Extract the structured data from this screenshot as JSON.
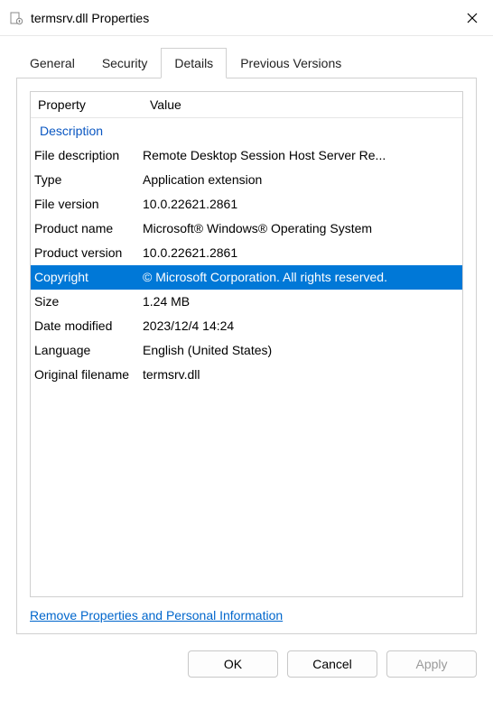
{
  "window": {
    "title": "termsrv.dll Properties"
  },
  "tabs": {
    "general": "General",
    "security": "Security",
    "details": "Details",
    "previous_versions": "Previous Versions",
    "active": "details"
  },
  "grid": {
    "header_property": "Property",
    "header_value": "Value",
    "group_description": "Description",
    "rows": [
      {
        "label": "File description",
        "value": "Remote Desktop Session Host Server Re..."
      },
      {
        "label": "Type",
        "value": "Application extension"
      },
      {
        "label": "File version",
        "value": "10.0.22621.2861"
      },
      {
        "label": "Product name",
        "value": "Microsoft® Windows® Operating System"
      },
      {
        "label": "Product version",
        "value": "10.0.22621.2861"
      },
      {
        "label": "Copyright",
        "value": "© Microsoft Corporation. All rights reserved."
      },
      {
        "label": "Size",
        "value": "1.24 MB"
      },
      {
        "label": "Date modified",
        "value": "2023/12/4 14:24"
      },
      {
        "label": "Language",
        "value": "English (United States)"
      },
      {
        "label": "Original filename",
        "value": "termsrv.dll"
      }
    ],
    "selected_index": 5
  },
  "link": {
    "remove_personal": "Remove Properties and Personal Information"
  },
  "buttons": {
    "ok": "OK",
    "cancel": "Cancel",
    "apply": "Apply"
  }
}
